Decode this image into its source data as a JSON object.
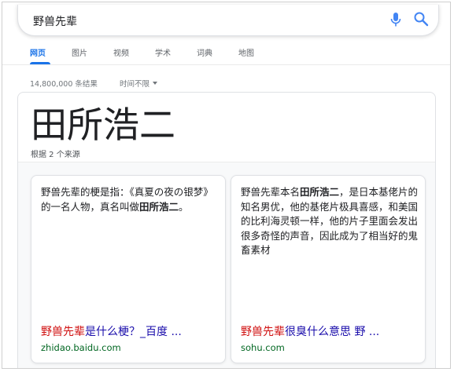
{
  "search": {
    "query": "野兽先辈"
  },
  "tabs": [
    {
      "label": "网页",
      "active": true
    },
    {
      "label": "图片",
      "active": false
    },
    {
      "label": "视频",
      "active": false
    },
    {
      "label": "学术",
      "active": false
    },
    {
      "label": "词典",
      "active": false
    },
    {
      "label": "地图",
      "active": false
    }
  ],
  "results_meta": {
    "count": "14,800,000 条结果",
    "time_filter": "时间不限"
  },
  "answer": {
    "title": "田所浩二",
    "subtitle": "根据 2 个来源",
    "sources": [
      {
        "text_before": "野兽先辈的梗是指：《真夏の夜の银梦》的一名人物，真名叫做",
        "text_bold": "田所浩二",
        "text_after": "。",
        "link_highlight": "野兽先辈",
        "link_rest": "是什么梗？_百度 ...",
        "domain": "zhidao.baidu.com"
      },
      {
        "text_before": "野兽先辈本名",
        "text_bold": "田所浩二",
        "text_after": "，是日本基佬片的知名男优，他的基佬片极具喜感，和美国的比利海灵顿一样，他的片子里面会发出很多奇怪的声音，因此成为了相当好的鬼畜素材",
        "link_highlight": "野兽先辈",
        "link_rest": "很臭什么意思 野 ...",
        "domain": "sohu.com"
      }
    ]
  },
  "colors": {
    "accent": "#1a73e8",
    "link": "#1a0dab",
    "highlight": "#d01010",
    "domain": "#006621"
  }
}
